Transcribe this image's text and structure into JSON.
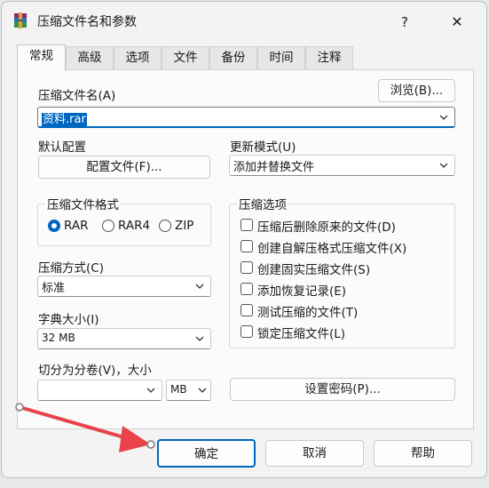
{
  "window": {
    "title": "压缩文件名和参数",
    "help_glyph": "?",
    "close_glyph": "✕"
  },
  "tabs": [
    "常规",
    "高级",
    "选项",
    "文件",
    "备份",
    "时间",
    "注释"
  ],
  "general": {
    "archive_name_label": "压缩文件名(A)",
    "browse_button": "浏览(B)...",
    "archive_name_value": "资料.rar",
    "default_profile_label": "默认配置",
    "profiles_button": "配置文件(F)...",
    "update_mode_label": "更新模式(U)",
    "update_mode_value": "添加并替换文件",
    "archive_format": {
      "title": "压缩文件格式",
      "options": [
        "RAR",
        "RAR4",
        "ZIP"
      ],
      "selected": "RAR"
    },
    "archive_options": {
      "title": "压缩选项",
      "items": [
        "压缩后删除原来的文件(D)",
        "创建自解压格式压缩文件(X)",
        "创建固实压缩文件(S)",
        "添加恢复记录(E)",
        "测试压缩的文件(T)",
        "锁定压缩文件(L)"
      ]
    },
    "compression_method_label": "压缩方式(C)",
    "compression_method_value": "标准",
    "dictionary_size_label": "字典大小(I)",
    "dictionary_size_value": "32 MB",
    "split_label": "切分为分卷(V)，大小",
    "split_size_value": "",
    "split_unit_value": "MB",
    "set_password_button": "设置密码(P)..."
  },
  "footer": {
    "ok": "确定",
    "cancel": "取消",
    "help": "帮助"
  },
  "colors": {
    "accent": "#0067c0",
    "annotation_arrow": "#e8434b"
  },
  "icons": {
    "app": "winrar-icon",
    "chevron": "chevron-down-icon",
    "close": "close-icon"
  }
}
